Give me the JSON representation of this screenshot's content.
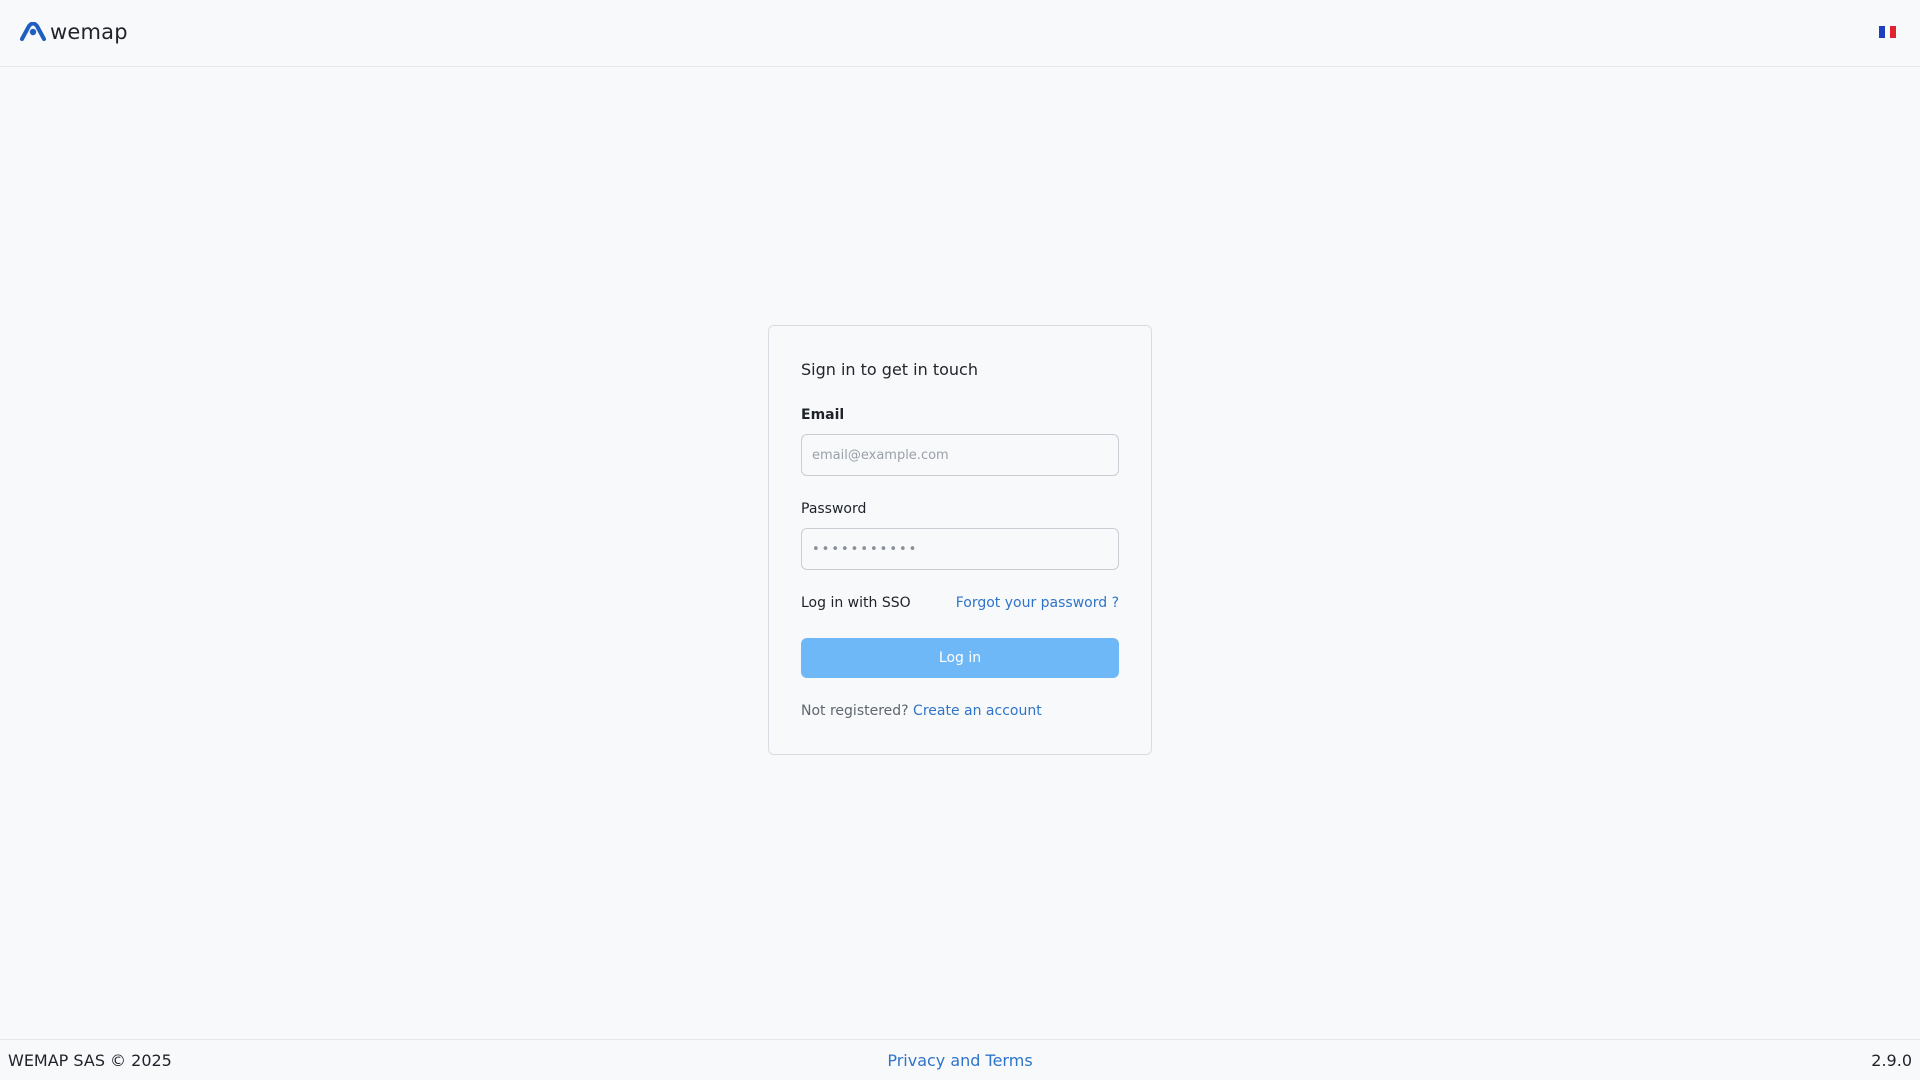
{
  "header": {
    "brand": "wemap",
    "brand_color": "#1f5fbf",
    "language_flag": "france-flag-icon",
    "flag_colors": [
      "#1d3fc2",
      "#ffffff",
      "#e0242b"
    ]
  },
  "login_card": {
    "title": "Sign in to get in touch",
    "email_label": "Email",
    "email_placeholder": "email@example.com",
    "email_value": "",
    "password_label": "Password",
    "password_placeholder": "•••••••••••",
    "password_value": "",
    "sso_label": "Log in with SSO",
    "forgot_label": "Forgot your password ?",
    "login_button_label": "Log in",
    "login_button_color": "#6fb8f7",
    "register_prompt": "Not registered?",
    "register_link": "Create an account"
  },
  "footer": {
    "copyright": "WEMAP SAS © 2025",
    "privacy_link": "Privacy and Terms",
    "version": "2.9.0"
  },
  "colors": {
    "link": "#2f74c8",
    "background": "#f7f9fb"
  }
}
